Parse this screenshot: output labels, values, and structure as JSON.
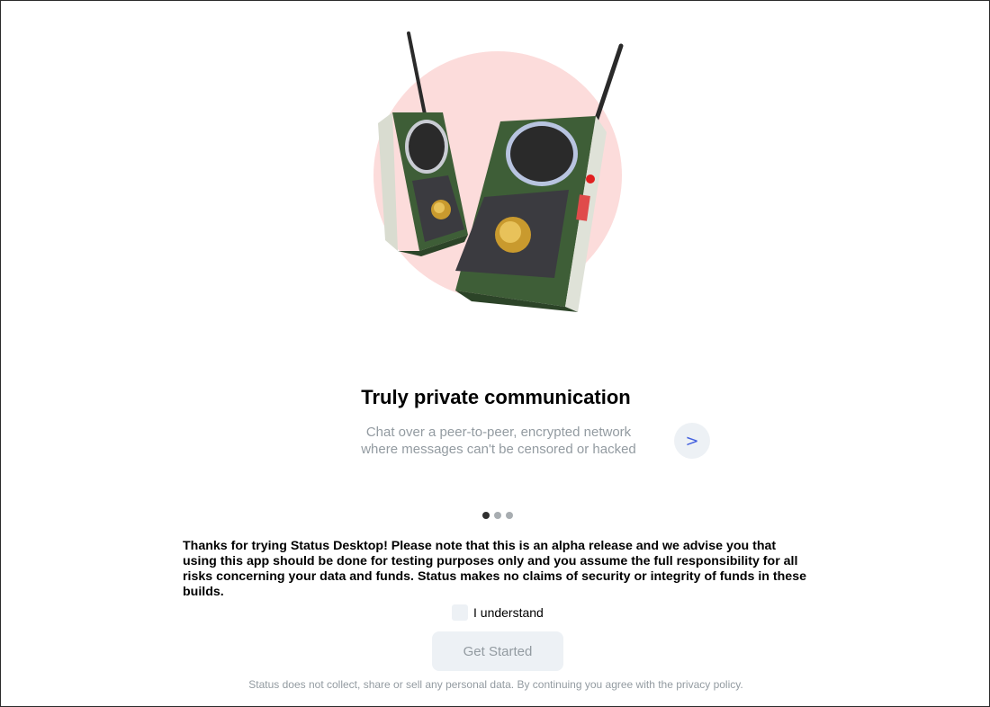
{
  "onboarding": {
    "title": "Truly private communication",
    "subtitle": "Chat over a peer-to-peer, encrypted network\nwhere messages can't be censored or hacked",
    "next_label": ">",
    "carousel": {
      "total_pages": 3,
      "current_page": 1
    }
  },
  "alpha_notice": "Thanks for trying Status Desktop! Please note that this is an alpha release and we advise you that using this app should be done for testing purposes only and you assume the full responsibility for all risks concerning your data and funds. Status makes no claims of security or integrity of funds in these builds.",
  "understand": {
    "label": "I understand",
    "checked": false
  },
  "get_started": {
    "label": "Get Started",
    "enabled": false
  },
  "privacy_text": "Status does not collect, share or sell any personal data. By continuing you agree with the privacy policy.",
  "colors": {
    "accent": "#4360df",
    "secondary_text": "#939ba1",
    "button_bg": "#edf1f5",
    "hero_circle": "#fcdcdb",
    "radio_green": "#3e5e37"
  },
  "icons": {
    "hero": "walkie-talkie-illustration",
    "next": "chevron-right-icon"
  }
}
